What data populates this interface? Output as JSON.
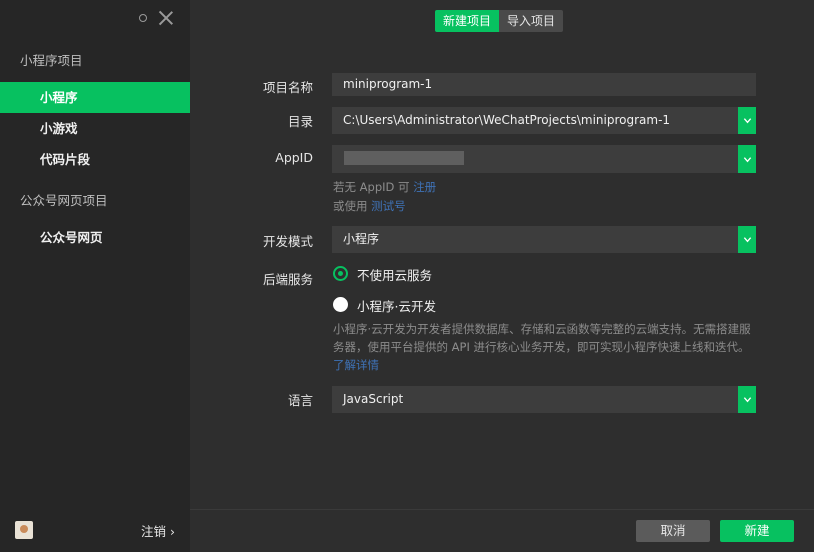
{
  "sidebar": {
    "section1_title": "小程序项目",
    "items": [
      {
        "label": "小程序",
        "active": true
      },
      {
        "label": "小游戏",
        "active": false
      },
      {
        "label": "代码片段",
        "active": false
      }
    ],
    "section2_title": "公众号网页项目",
    "items2": [
      {
        "label": "公众号网页",
        "active": false
      }
    ],
    "logout_label": "注销",
    "logout_chevron": "›"
  },
  "tabs": {
    "new_project": "新建项目",
    "import_project": "导入项目"
  },
  "form": {
    "project_name_label": "项目名称",
    "project_name_value": "miniprogram-1",
    "directory_label": "目录",
    "directory_value": "C:\\Users\\Administrator\\WeChatProjects\\miniprogram-1",
    "appid_label": "AppID",
    "appid_hint_prefix": "若无 AppID 可",
    "appid_hint_link": "注册",
    "appid_hint2_prefix": "或使用",
    "appid_hint2_link": "测试号",
    "dev_mode_label": "开发模式",
    "dev_mode_value": "小程序",
    "backend_label": "后端服务",
    "backend_option1": "不使用云服务",
    "backend_option2": "小程序·云开发",
    "backend_desc": "小程序·云开发为开发者提供数据库、存储和云函数等完整的云端支持。无需搭建服务器，使用平台提供的 API 进行核心业务开发，即可实现小程序快速上线和迭代。",
    "backend_desc_link": "了解详情",
    "language_label": "语言",
    "language_value": "JavaScript"
  },
  "buttons": {
    "cancel": "取消",
    "create": "新建"
  },
  "colors": {
    "accent": "#07c160",
    "link": "#3f72b6"
  }
}
